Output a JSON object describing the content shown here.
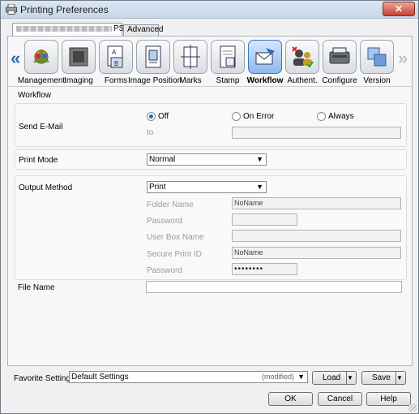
{
  "window": {
    "title": "Printing Preferences",
    "close_glyph": "✕"
  },
  "tabs": {
    "driver_tab_suffix": "PS",
    "advanced_tab": "Advanced"
  },
  "toolbar": {
    "prev_arrow": "«",
    "next_arrow": "»",
    "items": [
      {
        "label": "Management",
        "icon": "palette-gear-icon"
      },
      {
        "label": "Imaging",
        "icon": "imaging-icon"
      },
      {
        "label": "Forms",
        "icon": "forms-icon"
      },
      {
        "label": "Image Position",
        "icon": "image-position-icon"
      },
      {
        "label": "Marks",
        "icon": "marks-icon"
      },
      {
        "label": "Stamp",
        "icon": "stamp-icon"
      },
      {
        "label": "Workflow",
        "icon": "workflow-icon",
        "selected": true
      },
      {
        "label": "Authent.",
        "icon": "authentication-icon"
      },
      {
        "label": "Configure",
        "icon": "configure-icon"
      },
      {
        "label": "Version",
        "icon": "version-icon"
      }
    ]
  },
  "workflow": {
    "section_title": "Workflow",
    "send_email": {
      "label": "Send E-Mail",
      "options": [
        "Off",
        "On Error",
        "Always"
      ],
      "selected": "Off",
      "to_label": "to",
      "to_value": ""
    },
    "print_mode": {
      "label": "Print Mode",
      "value": "Normal"
    },
    "output_method": {
      "label": "Output Method",
      "value": "Print",
      "folder_name_label": "Folder Name",
      "folder_name_value": "NoName",
      "password_label": "Password",
      "password_value": "",
      "user_box_label": "User Box Name",
      "user_box_value": "",
      "secure_id_label": "Secure Print ID",
      "secure_id_value": "NoName",
      "password2_label": "Password",
      "password2_value": "••••••••"
    },
    "file_name": {
      "label": "File Name",
      "value": ""
    }
  },
  "favorite": {
    "label": "Favorite Setting",
    "value": "Default Settings",
    "modified": "(modified)",
    "load_label": "Load",
    "save_label": "Save"
  },
  "dialog_buttons": {
    "ok": "OK",
    "cancel": "Cancel",
    "help": "Help"
  },
  "colors": {
    "accent": "#2f6ab8",
    "selected_tab": "#8db9ec",
    "close": "#c7432f"
  }
}
